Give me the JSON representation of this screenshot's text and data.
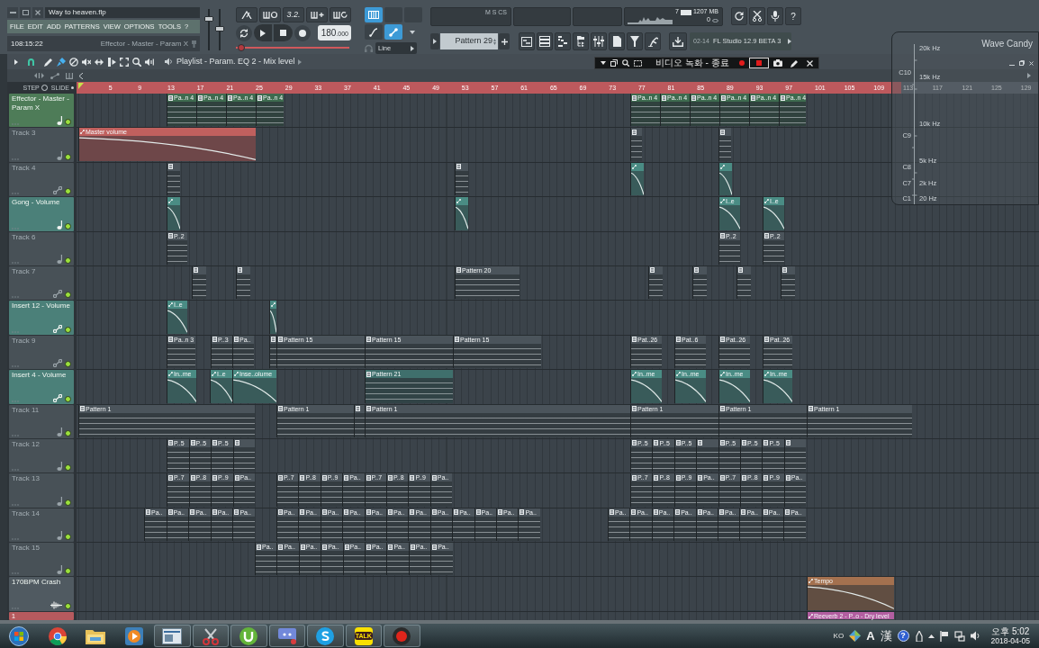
{
  "window": {
    "title": "Way to heaven.flp"
  },
  "menu": [
    "FILE",
    "EDIT",
    "ADD",
    "PATTERNS",
    "VIEW",
    "OPTIONS",
    "TOOLS",
    "?"
  ],
  "hint_bar": {
    "time": "108:15:22",
    "hint": "Effector - Master - Param X"
  },
  "master_sliders": [
    {
      "level": 0.8
    },
    {
      "level": 0.52
    }
  ],
  "transport": {
    "options": [
      {
        "kind": "metronome"
      },
      {
        "kind": "wait"
      },
      {
        "kind": "countdown",
        "label": "3.2."
      },
      {
        "kind": "step"
      },
      {
        "kind": "loop-record"
      }
    ],
    "tempo": "180.000",
    "position": {
      "level": 0.02
    }
  },
  "recording": {
    "toggles": [
      {
        "kind": "keyboard",
        "on": true
      },
      {
        "kind": "curve",
        "on": false
      },
      {
        "kind": "link",
        "on": true
      }
    ],
    "snap": "Line"
  },
  "monitor": {
    "label": "M S CS",
    "cpu": "7",
    "memory": "1207 MB",
    "polyphony": "0"
  },
  "pattern_selector": {
    "value": "Pattern 29"
  },
  "news": {
    "date": "02-14",
    "headline": "FL Studio 12.9 BETA 3"
  },
  "help_button": "?",
  "playlist": {
    "title": "Playlist - Param. EQ 2 - Mix level",
    "magnet": {
      "on": true
    },
    "tools": [
      {
        "kind": "draw",
        "selected": false
      },
      {
        "kind": "paint",
        "selected": true
      },
      {
        "kind": "delete",
        "selected": false
      },
      {
        "kind": "mute",
        "selected": false
      },
      {
        "kind": "slip",
        "selected": false
      },
      {
        "kind": "slice",
        "selected": false
      },
      {
        "kind": "select",
        "selected": false
      },
      {
        "kind": "zoom",
        "selected": false
      },
      {
        "kind": "playback",
        "selected": false
      }
    ],
    "step_label": "STEP",
    "slide_label": "SLIDE",
    "ruler": [
      "5",
      "9",
      "13",
      "17",
      "21",
      "25",
      "29",
      "33",
      "37",
      "41",
      "45",
      "49",
      "53",
      "57",
      "61",
      "65",
      "69",
      "73",
      "77",
      "81",
      "85",
      "89",
      "93",
      "97",
      "101",
      "105",
      "109",
      "113",
      "117",
      "121",
      "125",
      "129"
    ],
    "tracks": [
      {
        "name": "Effector - Master - Param X",
        "color": "#4e7c58",
        "default_name": false,
        "kind": "pattern",
        "enabled": true,
        "clips": [
          {
            "kind": "pattern",
            "color": "#3e6b4f",
            "label": "Pa..n 4"
          },
          {
            "kind": "pattern",
            "color": "#3e6b4f",
            "label": "Pa..n 4"
          },
          {
            "kind": "pattern",
            "color": "#3e6b4f",
            "label": "Pa..n 4"
          },
          {
            "kind": "pattern",
            "color": "#3e6b4f",
            "label": "Pa..n 4"
          },
          {
            "kind": "pattern",
            "color": "#3e6b4f",
            "label": "Pa..n 4"
          },
          {
            "kind": "pattern",
            "color": "#3e6b4f",
            "label": "Pa..n 4"
          },
          {
            "kind": "pattern",
            "color": "#3e6b4f",
            "label": "Pa..n 4"
          },
          {
            "kind": "pattern",
            "color": "#3e6b4f",
            "label": "Pa..n 4"
          },
          {
            "kind": "pattern",
            "color": "#3e6b4f",
            "label": "Pa..n 4"
          },
          {
            "kind": "pattern",
            "color": "#3e6b4f",
            "label": "Pa..n 4"
          }
        ]
      },
      {
        "name": "Track 3",
        "color": "#485157",
        "default_name": true,
        "kind": "pattern",
        "enabled": true,
        "clips": [
          {
            "kind": "automation",
            "color": "#c0605e",
            "label": "Master volume"
          },
          {
            "kind": "pattern",
            "color": "#4b545b"
          },
          {
            "kind": "pattern",
            "color": "#4b545b"
          }
        ]
      },
      {
        "name": "Track 4",
        "color": "#485157",
        "default_name": true,
        "kind": "automation",
        "enabled": true,
        "clips": [
          {
            "kind": "pattern",
            "color": "#4b545b"
          },
          {
            "kind": "pattern",
            "color": "#4b545b"
          },
          {
            "kind": "automation",
            "color": "#4a8c84"
          },
          {
            "kind": "automation",
            "color": "#4a8c84"
          }
        ]
      },
      {
        "name": "Gong - Volume",
        "color": "#4b8079",
        "default_name": false,
        "kind": "pattern",
        "enabled": true,
        "clips": [
          {
            "kind": "automation",
            "color": "#4a8c84"
          },
          {
            "kind": "automation",
            "color": "#4a8c84"
          },
          {
            "kind": "automation",
            "color": "#4a8c84",
            "label": "I..e"
          },
          {
            "kind": "automation",
            "color": "#4a8c84",
            "label": "I..e"
          }
        ]
      },
      {
        "name": "Track 6",
        "color": "#485157",
        "default_name": true,
        "kind": "pattern",
        "enabled": true,
        "clips": [
          {
            "kind": "pattern",
            "color": "#4b545b",
            "label": "P..2"
          },
          {
            "kind": "pattern",
            "color": "#4b545b",
            "label": "P..2"
          },
          {
            "kind": "pattern",
            "color": "#4b545b",
            "label": "P..2"
          }
        ]
      },
      {
        "name": "Track 7",
        "color": "#485157",
        "default_name": true,
        "kind": "automation",
        "enabled": true,
        "clips": [
          {
            "kind": "pattern",
            "color": "#4b545b"
          },
          {
            "kind": "pattern",
            "color": "#4b545b"
          },
          {
            "kind": "pattern",
            "color": "#4b545b",
            "label": "Pattern 20"
          },
          {
            "kind": "pattern",
            "color": "#4b545b"
          },
          {
            "kind": "pattern",
            "color": "#4b545b"
          },
          {
            "kind": "pattern",
            "color": "#4b545b"
          },
          {
            "kind": "pattern",
            "color": "#4b545b"
          }
        ]
      },
      {
        "name": "Insert 12 - Volume",
        "color": "#4b8079",
        "default_name": false,
        "kind": "automation",
        "enabled": true,
        "clips": [
          {
            "kind": "automation",
            "color": "#4a8c84",
            "label": "I..e"
          },
          {
            "kind": "automation",
            "color": "#4a8c84"
          }
        ]
      },
      {
        "name": "Track 9",
        "color": "#485157",
        "default_name": true,
        "kind": "automation",
        "enabled": true,
        "clips": [
          {
            "kind": "pattern",
            "color": "#4b545b",
            "label": "Pa..n 3"
          },
          {
            "kind": "pattern",
            "color": "#4b545b",
            "label": "P..3"
          },
          {
            "kind": "pattern",
            "color": "#4b545b",
            "label": "Pa.."
          },
          {
            "kind": "pattern",
            "color": "#4b545b"
          },
          {
            "kind": "pattern",
            "color": "#4b545b",
            "label": "Pattern 15"
          },
          {
            "kind": "pattern",
            "color": "#4b545b",
            "label": "Pattern 15"
          },
          {
            "kind": "pattern",
            "color": "#4b545b",
            "label": "Pattern 15"
          },
          {
            "kind": "pattern",
            "color": "#4b545b",
            "label": "Pat..26"
          },
          {
            "kind": "pattern",
            "color": "#4b545b",
            "label": "Pat..6"
          },
          {
            "kind": "pattern",
            "color": "#4b545b",
            "label": "Pat..26"
          },
          {
            "kind": "pattern",
            "color": "#4b545b",
            "label": "Pat..26"
          }
        ]
      },
      {
        "name": "Insert 4 - Volume",
        "color": "#4b8079",
        "default_name": false,
        "kind": "automation",
        "enabled": true,
        "clips": [
          {
            "kind": "automation",
            "color": "#4a8c84",
            "label": "In..me"
          },
          {
            "kind": "automation",
            "color": "#4a8c84",
            "label": "I..e"
          },
          {
            "kind": "automation",
            "color": "#4a8c84",
            "label": "Inse..olume"
          },
          {
            "kind": "pattern",
            "color": "#3f6f6c",
            "label": "Pattern 21"
          },
          {
            "kind": "automation",
            "color": "#4a8c84",
            "label": "In..me"
          },
          {
            "kind": "automation",
            "color": "#4a8c84",
            "label": "In..me"
          },
          {
            "kind": "automation",
            "color": "#4a8c84",
            "label": "In..me"
          },
          {
            "kind": "automation",
            "color": "#4a8c84",
            "label": "In..me"
          }
        ]
      },
      {
        "name": "Track 11",
        "color": "#485157",
        "default_name": true,
        "kind": "pattern",
        "enabled": true,
        "clips": [
          {
            "kind": "pattern",
            "color": "#4b545b",
            "label": "Pattern 1"
          },
          {
            "kind": "pattern",
            "color": "#4b545b",
            "label": "Pattern 1"
          },
          {
            "kind": "pattern",
            "color": "#4b545b"
          },
          {
            "kind": "pattern",
            "color": "#4b545b",
            "label": "Pattern 1"
          },
          {
            "kind": "pattern",
            "color": "#4b545b",
            "label": "Pattern 1"
          },
          {
            "kind": "pattern",
            "color": "#4b545b",
            "label": "Pattern 1"
          },
          {
            "kind": "pattern",
            "color": "#4b545b",
            "label": "Pattern 1"
          }
        ]
      },
      {
        "name": "Track 12",
        "color": "#485157",
        "default_name": true,
        "kind": "pattern",
        "enabled": true,
        "clips": [
          {
            "kind": "pattern",
            "color": "#4b545b",
            "label": "P..5"
          },
          {
            "kind": "pattern",
            "color": "#4b545b",
            "label": "P..5"
          },
          {
            "kind": "pattern",
            "color": "#4b545b",
            "label": "P..5"
          },
          {
            "kind": "pattern",
            "color": "#4b545b"
          },
          {
            "kind": "pattern",
            "color": "#4b545b",
            "label": "P..5"
          },
          {
            "kind": "pattern",
            "color": "#4b545b",
            "label": "P..5"
          },
          {
            "kind": "pattern",
            "color": "#4b545b",
            "label": "P..5"
          },
          {
            "kind": "pattern",
            "color": "#4b545b"
          },
          {
            "kind": "pattern",
            "color": "#4b545b",
            "label": "P..5"
          },
          {
            "kind": "pattern",
            "color": "#4b545b",
            "label": "P..5"
          },
          {
            "kind": "pattern",
            "color": "#4b545b",
            "label": "P..5"
          },
          {
            "kind": "pattern",
            "color": "#4b545b"
          }
        ]
      },
      {
        "name": "Track 13",
        "color": "#485157",
        "default_name": true,
        "kind": "pattern",
        "enabled": true,
        "clips": [
          {
            "kind": "pattern",
            "color": "#4b545b",
            "label": "P..7"
          },
          {
            "kind": "pattern",
            "color": "#4b545b",
            "label": "P..8"
          },
          {
            "kind": "pattern",
            "color": "#4b545b",
            "label": "P..9"
          },
          {
            "kind": "pattern",
            "color": "#4b545b",
            "label": "Pa.."
          },
          {
            "kind": "pattern",
            "color": "#4b545b",
            "label": "P..7"
          },
          {
            "kind": "pattern",
            "color": "#4b545b",
            "label": "P..8"
          },
          {
            "kind": "pattern",
            "color": "#4b545b",
            "label": "P..9"
          },
          {
            "kind": "pattern",
            "color": "#4b545b",
            "label": "Pa.."
          },
          {
            "kind": "pattern",
            "color": "#4b545b",
            "label": "P..7"
          },
          {
            "kind": "pattern",
            "color": "#4b545b",
            "label": "P..8"
          },
          {
            "kind": "pattern",
            "color": "#4b545b",
            "label": "P..9"
          },
          {
            "kind": "pattern",
            "color": "#4b545b",
            "label": "Pa.."
          },
          {
            "kind": "pattern",
            "color": "#4b545b",
            "label": "P..7"
          },
          {
            "kind": "pattern",
            "color": "#4b545b",
            "label": "P..8"
          },
          {
            "kind": "pattern",
            "color": "#4b545b",
            "label": "P..9"
          },
          {
            "kind": "pattern",
            "color": "#4b545b",
            "label": "Pa.."
          },
          {
            "kind": "pattern",
            "color": "#4b545b",
            "label": "P..7"
          },
          {
            "kind": "pattern",
            "color": "#4b545b",
            "label": "P..8"
          },
          {
            "kind": "pattern",
            "color": "#4b545b",
            "label": "P..9"
          },
          {
            "kind": "pattern",
            "color": "#4b545b",
            "label": "Pa.."
          }
        ]
      },
      {
        "name": "Track 14",
        "color": "#485157",
        "default_name": true,
        "kind": "pattern",
        "enabled": true,
        "clips": [
          {
            "kind": "pattern",
            "color": "#4b545b",
            "label": "Pa.."
          },
          {
            "kind": "pattern",
            "color": "#4b545b",
            "label": "Pa.."
          },
          {
            "kind": "pattern",
            "color": "#4b545b",
            "label": "Pa.."
          },
          {
            "kind": "pattern",
            "color": "#4b545b",
            "label": "Pa.."
          },
          {
            "kind": "pattern",
            "color": "#4b545b",
            "label": "Pa.."
          },
          {
            "kind": "pattern",
            "color": "#4b545b",
            "label": "Pa.."
          },
          {
            "kind": "pattern",
            "color": "#4b545b",
            "label": "Pa.."
          },
          {
            "kind": "pattern",
            "color": "#4b545b",
            "label": "Pa.."
          },
          {
            "kind": "pattern",
            "color": "#4b545b",
            "label": "Pa.."
          },
          {
            "kind": "pattern",
            "color": "#4b545b",
            "label": "Pa.."
          },
          {
            "kind": "pattern",
            "color": "#4b545b",
            "label": "Pa.."
          },
          {
            "kind": "pattern",
            "color": "#4b545b",
            "label": "Pa.."
          },
          {
            "kind": "pattern",
            "color": "#4b545b",
            "label": "Pa.."
          },
          {
            "kind": "pattern",
            "color": "#4b545b",
            "label": "Pa.."
          },
          {
            "kind": "pattern",
            "color": "#4b545b",
            "label": "Pa.."
          },
          {
            "kind": "pattern",
            "color": "#4b545b",
            "label": "Pa.."
          },
          {
            "kind": "pattern",
            "color": "#4b545b",
            "label": "Pa.."
          },
          {
            "kind": "pattern",
            "color": "#4b545b",
            "label": "Pa.."
          },
          {
            "kind": "pattern",
            "color": "#4b545b",
            "label": "Pa.."
          },
          {
            "kind": "pattern",
            "color": "#4b545b",
            "label": "Pa.."
          },
          {
            "kind": "pattern",
            "color": "#4b545b",
            "label": "Pa.."
          },
          {
            "kind": "pattern",
            "color": "#4b545b",
            "label": "Pa.."
          },
          {
            "kind": "pattern",
            "color": "#4b545b",
            "label": "Pa.."
          },
          {
            "kind": "pattern",
            "color": "#4b545b",
            "label": "Pa.."
          },
          {
            "kind": "pattern",
            "color": "#4b545b",
            "label": "Pa.."
          },
          {
            "kind": "pattern",
            "color": "#4b545b",
            "label": "Pa.."
          }
        ]
      },
      {
        "name": "Track 15",
        "color": "#485157",
        "default_name": true,
        "kind": "pattern",
        "enabled": true,
        "clips": [
          {
            "kind": "pattern",
            "color": "#4b545b",
            "label": "Pa.."
          },
          {
            "kind": "pattern",
            "color": "#4b545b",
            "label": "Pa.."
          },
          {
            "kind": "pattern",
            "color": "#4b545b",
            "label": "Pa.."
          },
          {
            "kind": "pattern",
            "color": "#4b545b",
            "label": "Pa.."
          },
          {
            "kind": "pattern",
            "color": "#4b545b",
            "label": "Pa.."
          },
          {
            "kind": "pattern",
            "color": "#4b545b",
            "label": "Pa.."
          },
          {
            "kind": "pattern",
            "color": "#4b545b",
            "label": "Pa.."
          },
          {
            "kind": "pattern",
            "color": "#4b545b",
            "label": "Pa.."
          },
          {
            "kind": "pattern",
            "color": "#4b545b",
            "label": "Pa.."
          }
        ]
      },
      {
        "name": "170BPM Crash",
        "color": "#505a61",
        "default_name": false,
        "kind": "audio",
        "enabled": true,
        "clips": [
          {
            "kind": "automation",
            "color": "#a4714f",
            "label": "Tempo"
          }
        ]
      }
    ],
    "cut_track": {
      "name": "1",
      "color": "#b65a5e",
      "clips": [
        {
          "kind": "automation",
          "color": "#b35ea1",
          "label": "Reeverb 2 - P..o - Dry level"
        }
      ]
    }
  },
  "wave_candy": {
    "title": "Wave Candy",
    "frequency_labels": [
      "20k Hz",
      "15k Hz",
      "10k Hz",
      "5k Hz",
      "2k Hz",
      "20 Hz"
    ],
    "note_labels": [
      "C10",
      "C9",
      "C8",
      "C7",
      "C1"
    ]
  },
  "recorder_bar": {
    "status": "비디오 녹화 - 종료"
  },
  "taskbar": {
    "apps": [
      {
        "kind": "start",
        "open": false
      },
      {
        "kind": "browser",
        "open": false
      },
      {
        "kind": "folder",
        "open": false
      },
      {
        "kind": "media",
        "open": false
      },
      {
        "kind": "window",
        "open": true
      },
      {
        "kind": "scissors",
        "open": true
      },
      {
        "kind": "torrent",
        "open": true
      },
      {
        "kind": "chat",
        "open": true
      },
      {
        "kind": "phone",
        "open": true
      },
      {
        "kind": "talk",
        "open": true,
        "label": "TALK"
      },
      {
        "kind": "record",
        "open": true
      }
    ],
    "tray": {
      "language": "KO",
      "input_mode": "A",
      "hanja": "漢",
      "help": "?",
      "time": "오후 5:02",
      "date": "2018-04-05"
    }
  }
}
